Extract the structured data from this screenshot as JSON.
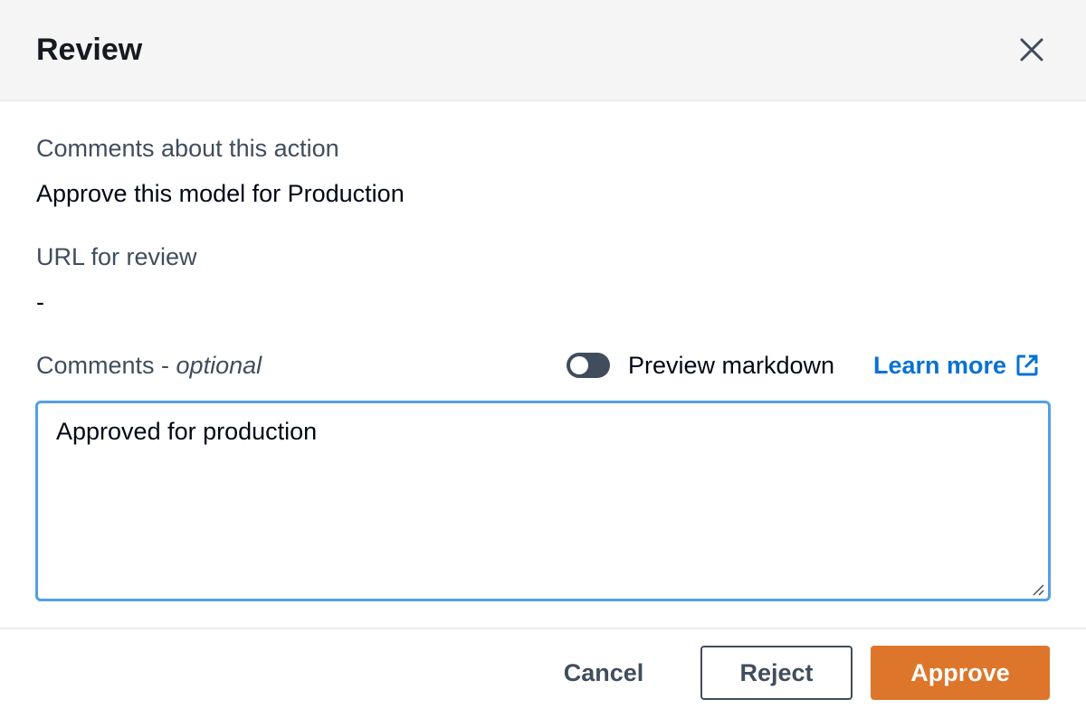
{
  "modal": {
    "title": "Review",
    "close_icon": "close-icon"
  },
  "details": {
    "comments_about_action_label": "Comments about this action",
    "comments_about_action_value": "Approve this model for Production",
    "url_label": "URL for review",
    "url_value": "-"
  },
  "comments": {
    "label": "Comments - ",
    "optional_label": "optional",
    "preview_markdown_label": "Preview markdown",
    "preview_markdown_enabled": false,
    "learn_more_label": "Learn more",
    "learn_more_icon": "external-link-icon",
    "value": "Approved for production"
  },
  "footer": {
    "cancel_label": "Cancel",
    "reject_label": "Reject",
    "approve_label": "Approve"
  },
  "colors": {
    "header_bg": "#f5f5f5",
    "link": "#0972d3",
    "primary_button": "#dd762a",
    "focus_border": "#539fe5",
    "toggle_off": "#414d5c"
  }
}
